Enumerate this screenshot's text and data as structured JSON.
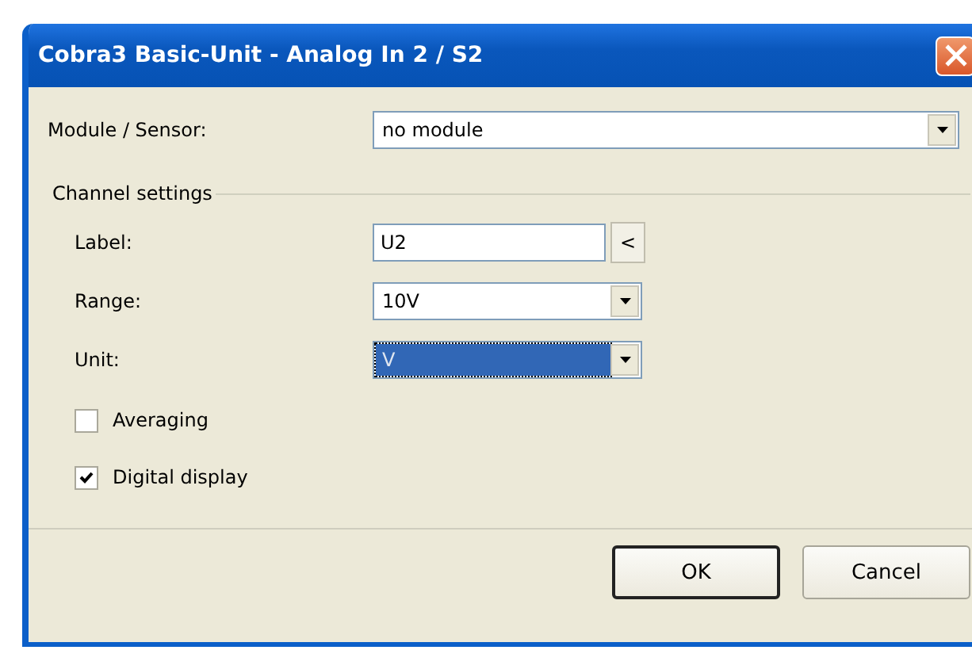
{
  "window": {
    "title": "Cobra3 Basic-Unit - Analog In 2 / S2"
  },
  "module_sensor": {
    "label": "Module / Sensor:",
    "value": "no module"
  },
  "channel_settings": {
    "title": "Channel settings",
    "fields": [
      {
        "kind": "text",
        "label": "Label:",
        "value": "U2",
        "button": "<",
        "focused": false
      },
      {
        "kind": "select",
        "label": "Range:",
        "value": "10V",
        "focused": false
      },
      {
        "kind": "select",
        "label": "Unit:",
        "value": "V",
        "focused": true
      }
    ],
    "checkboxes": [
      {
        "label": "Averaging",
        "checked": false
      },
      {
        "label": "Digital display",
        "checked": true
      }
    ]
  },
  "buttons": [
    {
      "label": "OK",
      "default": true
    },
    {
      "label": "Cancel",
      "default": false
    }
  ]
}
